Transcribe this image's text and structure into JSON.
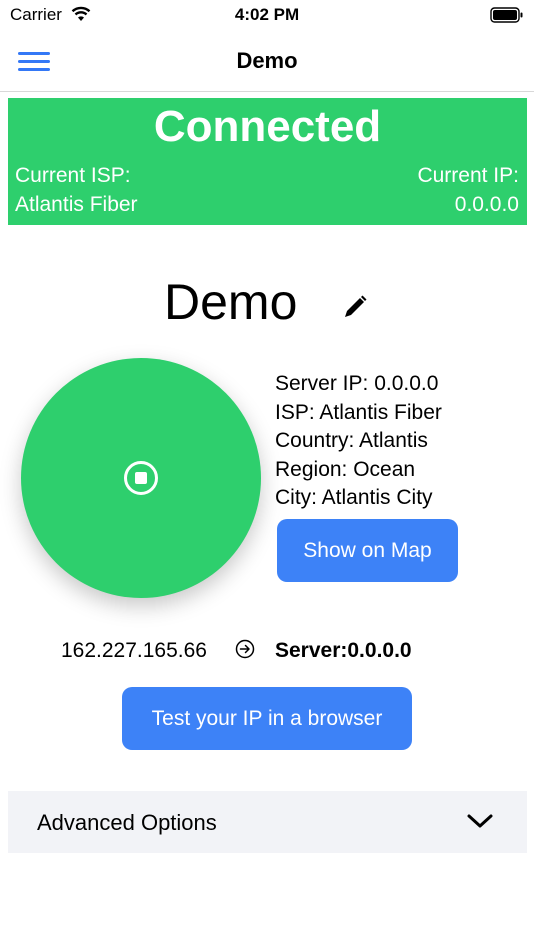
{
  "status_bar": {
    "carrier": "Carrier",
    "time": "4:02 PM",
    "icons": [
      "wifi-icon",
      "battery-icon"
    ]
  },
  "nav": {
    "title": "Demo",
    "menu_icon": "hamburger-menu-icon"
  },
  "banner": {
    "status": "Connected",
    "isp_label": "Current ISP:",
    "isp_value": "Atlantis Fiber",
    "ip_label": "Current IP:",
    "ip_value": "0.0.0.0",
    "color": "#2ecf6d"
  },
  "profile": {
    "name": "Demo",
    "edit_icon": "pencil-icon"
  },
  "connect_button": {
    "icon": "stop-icon",
    "color": "#2ecf6d"
  },
  "server": {
    "ip": "Server IP: 0.0.0.0",
    "isp": "ISP: Atlantis Fiber",
    "country": "Country: Atlantis",
    "region": "Region: Ocean",
    "city": "City: Atlantis City",
    "show_map_label": "Show on Map"
  },
  "route": {
    "client_ip": "162.227.165.66",
    "arrow_icon": "arrow-right-circle-icon",
    "server_label": "Server:0.0.0.0"
  },
  "test_button": {
    "label": "Test your IP in a browser",
    "color": "#3d82f7"
  },
  "advanced": {
    "label": "Advanced Options",
    "chevron_icon": "chevron-down-icon"
  }
}
